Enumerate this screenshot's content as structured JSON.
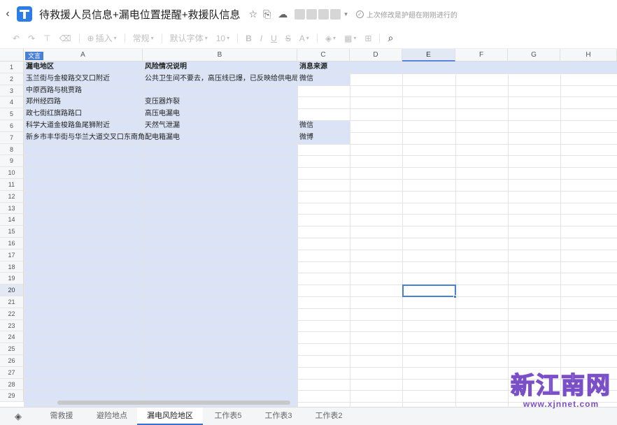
{
  "titlebar": {
    "title": "待救援人员信息+漏电位置提醒+救援队信息",
    "status": "上次修改是护翅在刚刚进行的"
  },
  "toolbar": {
    "insert_label": "插入",
    "format_label": "常规",
    "font_label": "默认字体",
    "size_label": "10"
  },
  "grid": {
    "font_tag": "文言",
    "columns": [
      "A",
      "B",
      "C",
      "D",
      "E",
      "F",
      "G",
      "H"
    ],
    "rows": [
      "1",
      "2",
      "3",
      "4",
      "5",
      "6",
      "7",
      "8",
      "9",
      "10",
      "11",
      "12",
      "13",
      "14",
      "15",
      "16",
      "17",
      "18",
      "19",
      "20",
      "21",
      "22",
      "23",
      "24",
      "25",
      "26",
      "27",
      "28",
      "29"
    ],
    "header_row": [
      "漏电地区",
      "风险情况说明",
      "消息来源"
    ],
    "data": [
      [
        "玉兰街与金梭路交叉口附近",
        "公共卫生间不要去，高压线已爆，已反映给供电局",
        "微信"
      ],
      [
        "中原西路与桃贾路",
        "",
        ""
      ],
      [
        "郑州经四路",
        "变压器炸裂",
        ""
      ],
      [
        "政七街红旗路路口",
        "高压电漏电",
        ""
      ],
      [
        "科学大道金梭路鱼尾狮附近",
        "天然气泄漏",
        "微信"
      ],
      [
        "新乡市丰华街与华兰大道交叉口东南角",
        "配电箱漏电",
        "微博"
      ]
    ]
  },
  "tabs": [
    "需救援",
    "避险地点",
    "漏电风险地区",
    "工作表5",
    "工作表3",
    "工作表2"
  ],
  "active_tab": "漏电风险地区",
  "watermark": {
    "name": "新江南网",
    "url": "www.xjnnet.com"
  },
  "colors": {
    "selection": "#dae4f6",
    "accent": "#4a7fd8",
    "watermark": "#7b4fc8"
  }
}
